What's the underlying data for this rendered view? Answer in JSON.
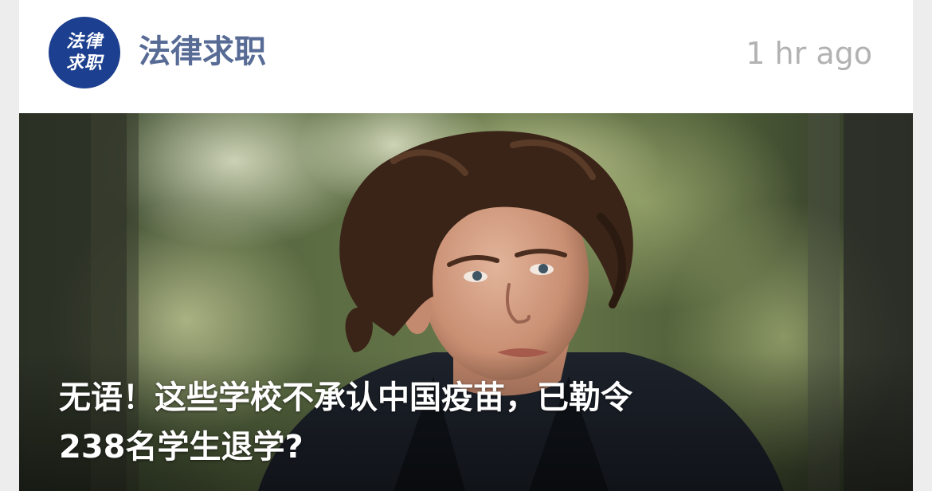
{
  "account": {
    "logo_line1": "法律",
    "logo_line2": "求职",
    "name": "法律求职",
    "timestamp": "1 hr ago"
  },
  "article": {
    "headline_line1": "无语！这些学校不承认中国疫苗，已勒令",
    "headline_line2": "238名学生退学?"
  },
  "colors": {
    "account_name": "#576b95",
    "logo_bg": "#1c3f8f",
    "timestamp": "#b2b2b2"
  }
}
